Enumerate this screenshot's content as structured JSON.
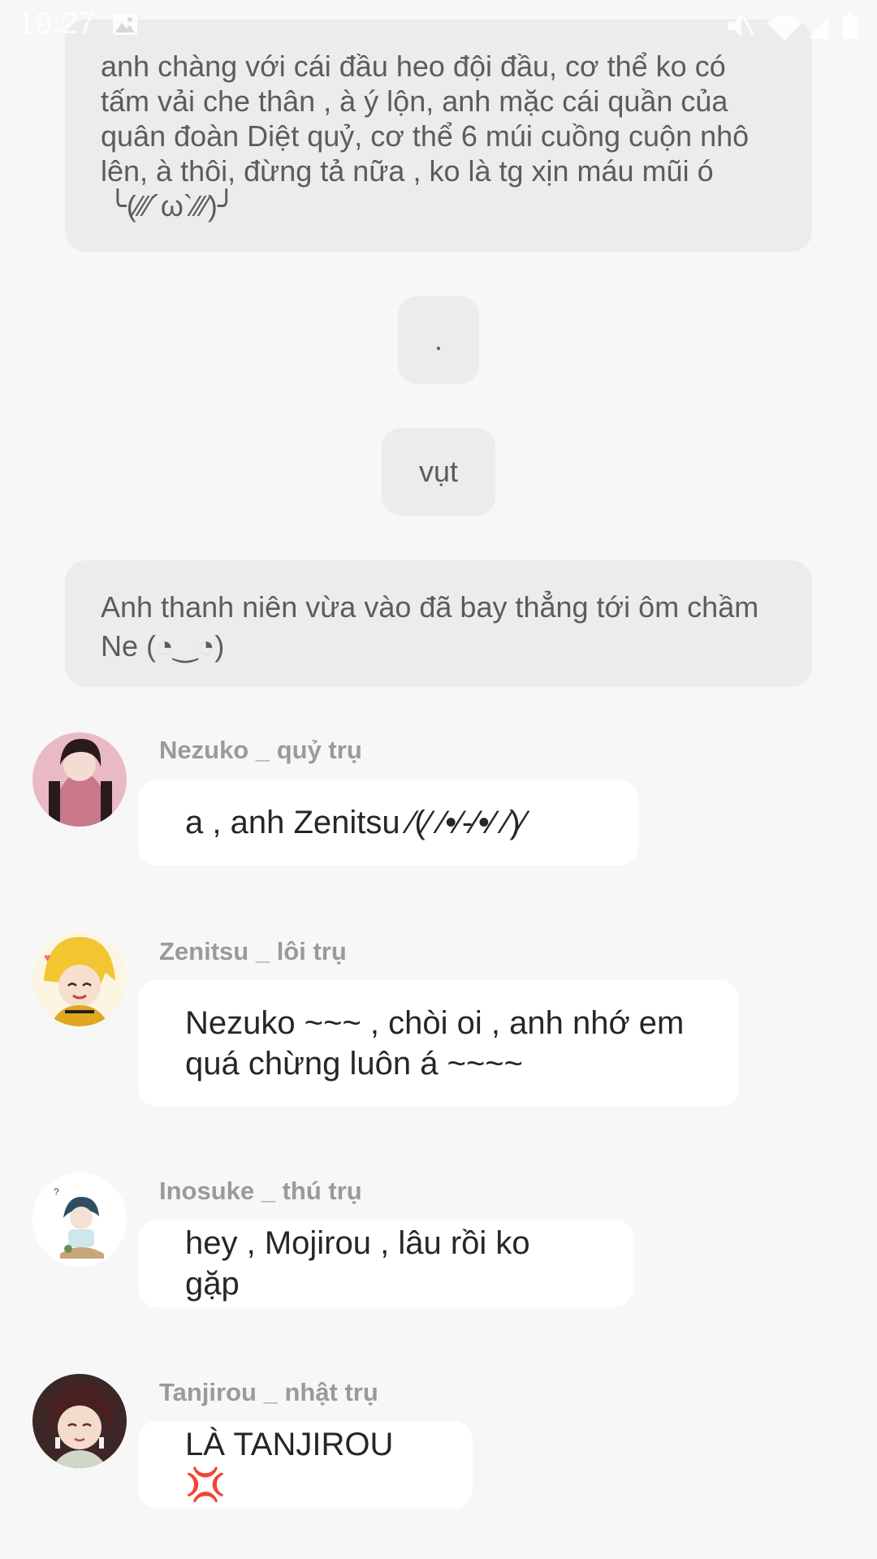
{
  "status_bar": {
    "time": "19:27"
  },
  "narration": [
    {
      "text": "anh chàng với cái đầu heo đội đầu, cơ thể ko có\ntấm vải che thân , à ý lộn, anh mặc cái quần của\nquân đoàn Diệt quỷ, cơ thể 6 múi cuồng cuộn nhô\nlên, à thôi, đừng tả nữa , ko là tg xịn máu mũi ó\n ╰(⁄⁄⁄´ω`⁄⁄⁄)╯"
    },
    {
      "text": "."
    },
    {
      "text": "vụt"
    },
    {
      "text": "Anh thanh niên vừa vào đã bay thẳng tới ôm chầm\nNe (◔‿◔)"
    }
  ],
  "messages": [
    {
      "speaker": "Nezuko _ quỷ trụ",
      "text": "a , anh Zenitsu ⁄(⁄ ⁄•⁄-⁄•⁄ ⁄)⁄",
      "avatar_color": "#d98fa0"
    },
    {
      "speaker": "Zenitsu _ lôi trụ",
      "text": "Nezuko ~~~ , chòi oi , anh nhớ em\nquá chừng luôn á ~~~~",
      "avatar_color": "#f2c531"
    },
    {
      "speaker": "Inosuke _ thú trụ",
      "text": "hey , Mojirou , lâu rồi ko gặp",
      "avatar_color": "#ffffff"
    },
    {
      "speaker": "Tanjirou _ nhật trụ",
      "text": "LÀ TANJIROU 💢",
      "avatar_color": "#5a2c2c"
    }
  ]
}
